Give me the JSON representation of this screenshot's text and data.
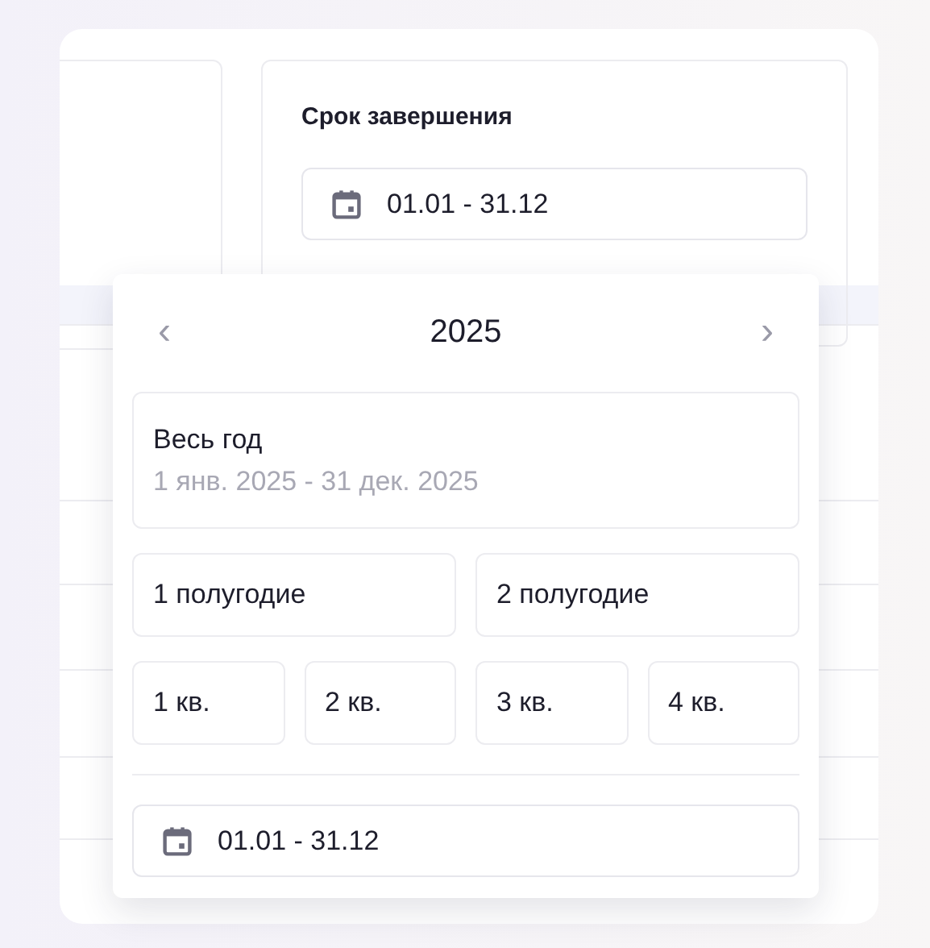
{
  "deadline_panel": {
    "title": "Срок завершения",
    "date_range": "01.01 - 31.12"
  },
  "period_picker": {
    "prev": "‹",
    "year": "2025",
    "next": "›",
    "whole_year": {
      "label": "Весь год",
      "range": "1 янв. 2025 - 31 дек. 2025"
    },
    "halves": [
      "1 полугодие",
      "2 полугодие"
    ],
    "quarters": [
      "1 кв.",
      "2 кв.",
      "3 кв.",
      "4 кв."
    ],
    "date_range": "01.01 - 31.12"
  }
}
